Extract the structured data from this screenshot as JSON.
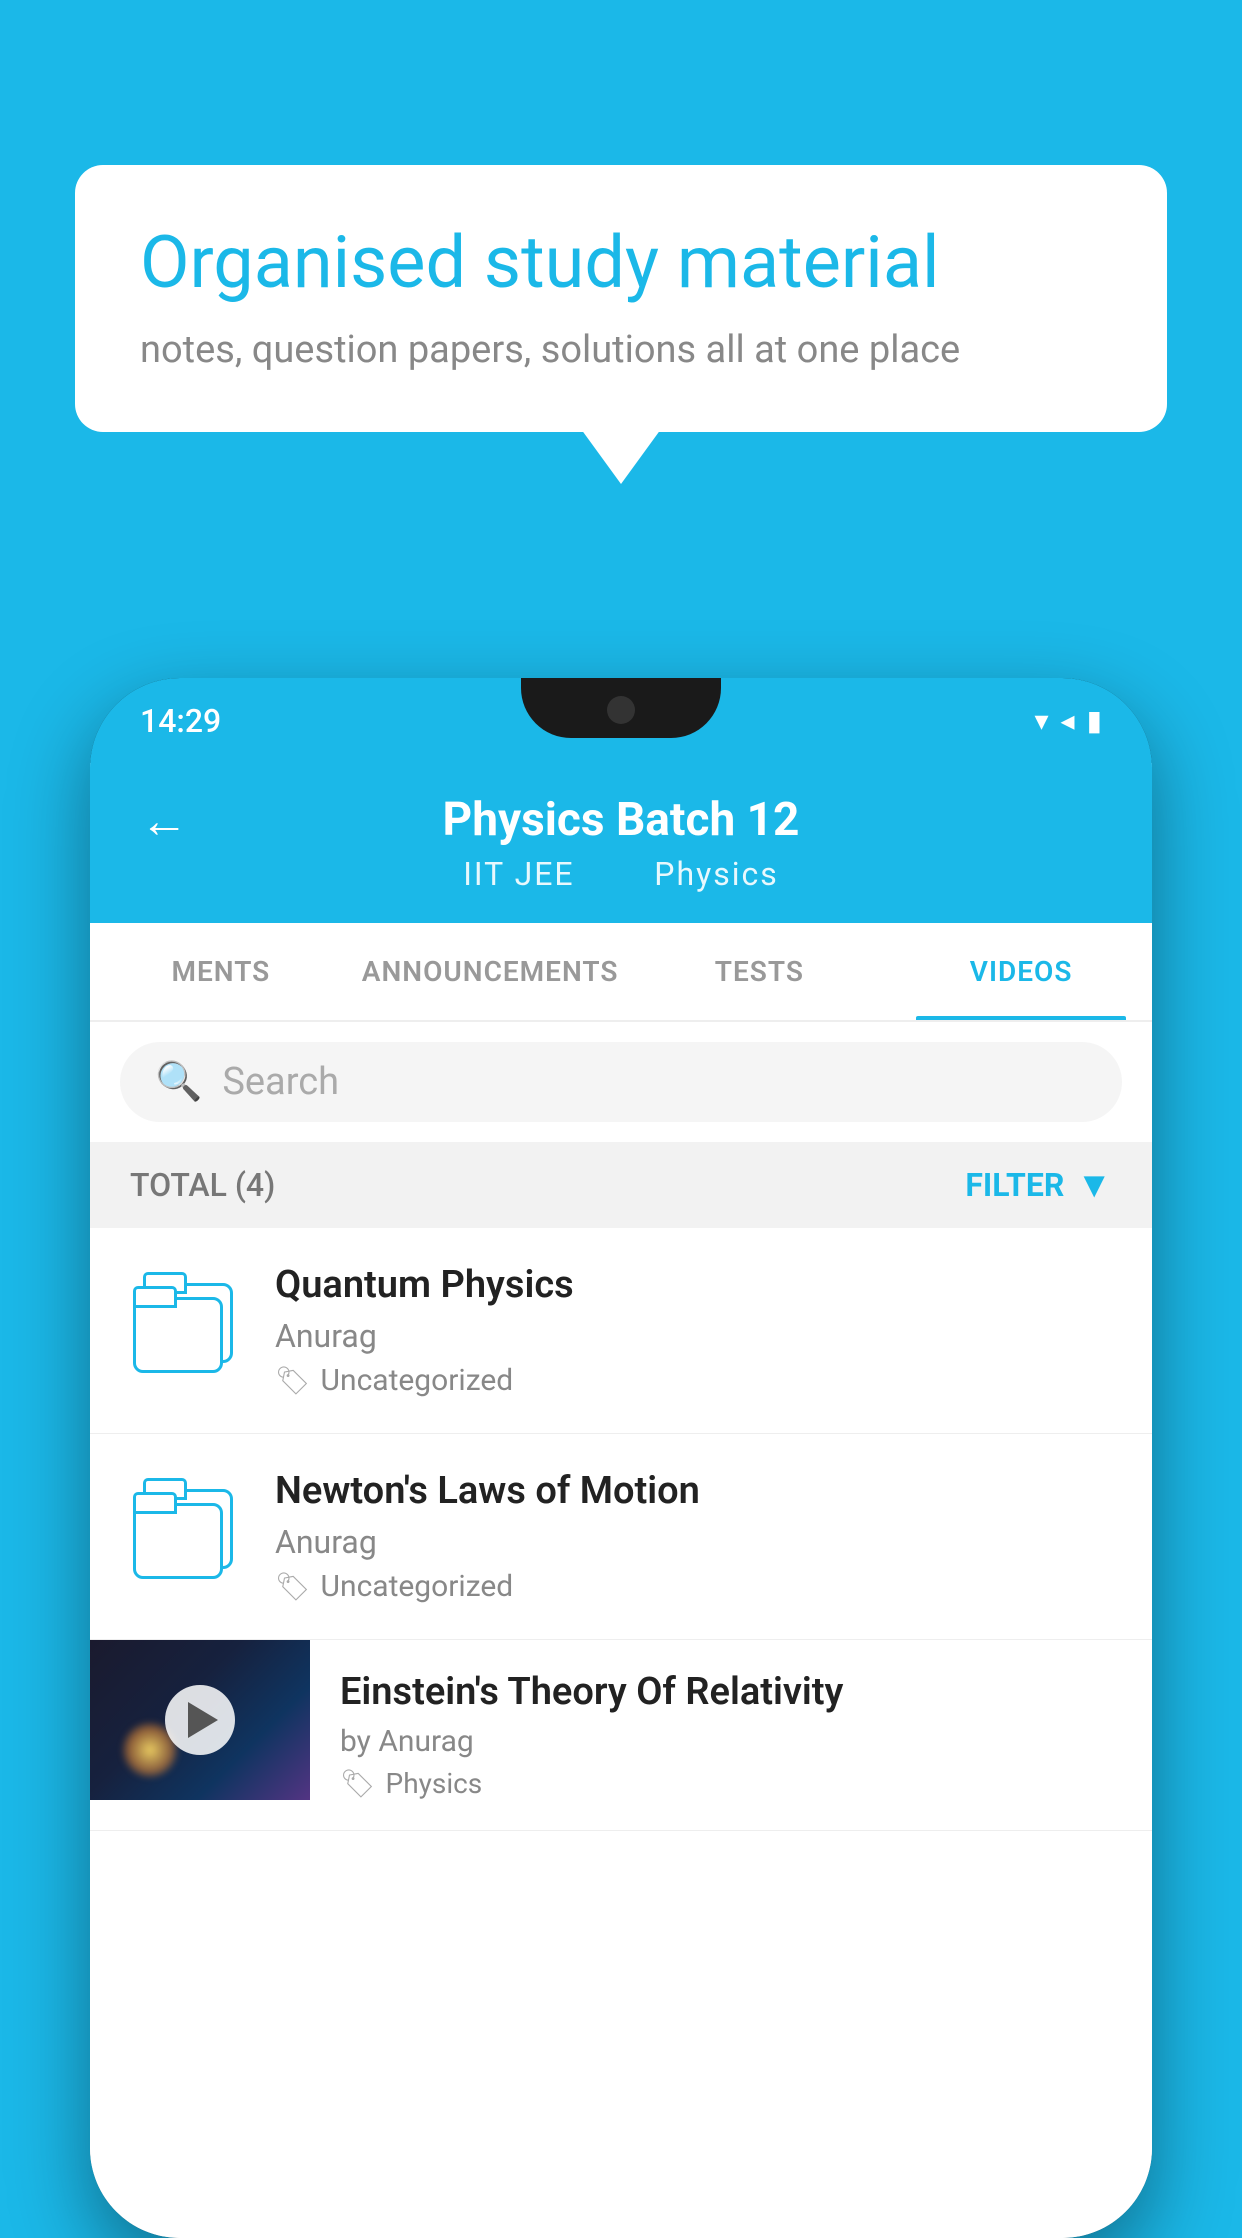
{
  "background_color": "#1BB8E8",
  "bubble": {
    "title": "Organised study material",
    "subtitle": "notes, question papers, solutions all at one place"
  },
  "phone": {
    "status_bar": {
      "time": "14:29",
      "icons": "▾◂▮"
    },
    "header": {
      "back_label": "←",
      "title": "Physics Batch 12",
      "subtitle_part1": "IIT JEE",
      "subtitle_part2": "Physics"
    },
    "tabs": [
      {
        "label": "MENTS",
        "active": false
      },
      {
        "label": "ANNOUNCEMENTS",
        "active": false
      },
      {
        "label": "TESTS",
        "active": false
      },
      {
        "label": "VIDEOS",
        "active": true
      }
    ],
    "search": {
      "placeholder": "Search"
    },
    "filter_row": {
      "total_label": "TOTAL (4)",
      "filter_label": "FILTER"
    },
    "videos": [
      {
        "id": 1,
        "title": "Quantum Physics",
        "author": "Anurag",
        "tag": "Uncategorized",
        "type": "folder"
      },
      {
        "id": 2,
        "title": "Newton's Laws of Motion",
        "author": "Anurag",
        "tag": "Uncategorized",
        "type": "folder"
      },
      {
        "id": 3,
        "title": "Einstein's Theory Of Relativity",
        "author": "by Anurag",
        "tag": "Physics",
        "type": "video"
      }
    ]
  }
}
